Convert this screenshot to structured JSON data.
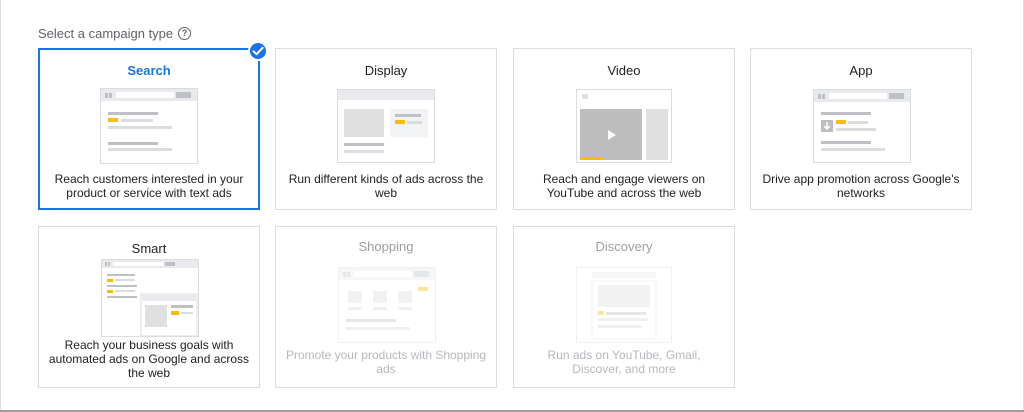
{
  "heading": {
    "text": "Select a campaign type",
    "help_icon": "help-circle-icon"
  },
  "accent_color": "#1a73e8",
  "cards": [
    {
      "title": "Search",
      "description": "Reach customers interested in your product or service with text ads",
      "selected": true,
      "enabled": true
    },
    {
      "title": "Display",
      "description": "Run different kinds of ads across the web",
      "selected": false,
      "enabled": true
    },
    {
      "title": "Video",
      "description": "Reach and engage viewers on YouTube and across the web",
      "selected": false,
      "enabled": true
    },
    {
      "title": "App",
      "description": "Drive app promotion across Google's networks",
      "selected": false,
      "enabled": true
    },
    {
      "title": "Smart",
      "description": "Reach your business goals with automated ads on Google and across the web",
      "selected": false,
      "enabled": true
    },
    {
      "title": "Shopping",
      "description": "Promote your products with Shopping ads",
      "selected": false,
      "enabled": false
    },
    {
      "title": "Discovery",
      "description": "Run ads on YouTube, Gmail, Discover, and more",
      "selected": false,
      "enabled": false
    }
  ]
}
